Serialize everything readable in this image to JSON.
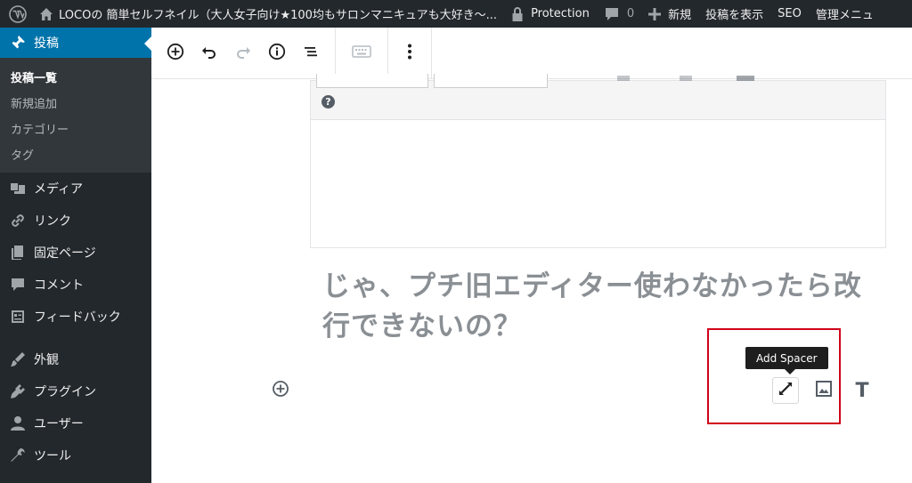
{
  "admin_bar": {
    "site_title": "LOCOの 簡単セルフネイル（大人女子向け★100均もサロンマニキュアも大好き〜...",
    "protection_label": "Protection",
    "comment_count": "0",
    "new_label": "新規",
    "view_post_label": "投稿を表示",
    "seo_label": "SEO",
    "admin_menu_label": "管理メニュ"
  },
  "sidebar": {
    "posts_label": "投稿",
    "submenu": [
      "投稿一覧",
      "新規追加",
      "カテゴリー",
      "タグ"
    ],
    "items": [
      {
        "label": "メディア",
        "icon": "media-icon"
      },
      {
        "label": "リンク",
        "icon": "link-icon"
      },
      {
        "label": "固定ページ",
        "icon": "page-icon"
      },
      {
        "label": "コメント",
        "icon": "comment-icon"
      },
      {
        "label": "フィードバック",
        "icon": "feedback-icon"
      },
      {
        "label": "外観",
        "icon": "appearance-icon"
      },
      {
        "label": "プラグイン",
        "icon": "plugin-icon"
      },
      {
        "label": "ユーザー",
        "icon": "user-icon"
      },
      {
        "label": "ツール",
        "icon": "tools-icon"
      }
    ]
  },
  "editor": {
    "classic_help": "?",
    "heading_text": "じゃ、プチ旧エディター使わなかったら改行できないの？",
    "tooltip": "Add Spacer",
    "paragraph_glyph": "T"
  },
  "colors": {
    "admin_dark": "#23282d",
    "submenu_bg": "#32373c",
    "accent_blue": "#0073aa",
    "highlight_red": "#d0021b"
  }
}
